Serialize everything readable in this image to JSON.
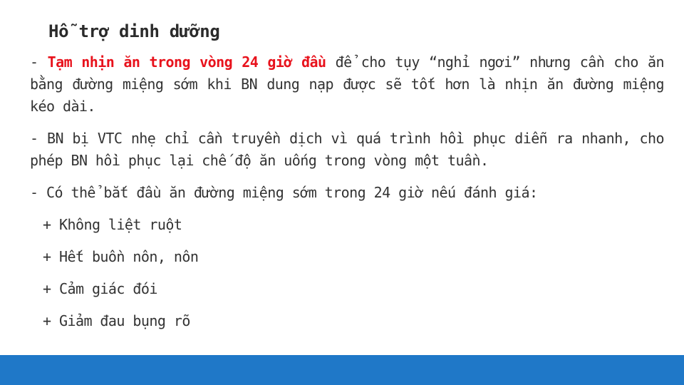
{
  "slide": {
    "title": "Hỗ trợ dinh dưỡng",
    "paragraphs": {
      "p1": {
        "prefix": " - ",
        "highlight": "Tạm nhịn ăn trong vòng 24 giờ đầu",
        "rest": " để cho tụy “nghỉ ngơi” nhưng cần cho ăn bằng đường miệng sớm khi BN dung nạp được sẽ tốt hơn là nhịn ăn đường miệng kéo dài."
      },
      "p2": " - BN bị VTC nhẹ chỉ cần truyền dịch vì quá trình hồi phục diễn ra nhanh, cho phép BN hồi phục lại chế độ ăn uống trong vòng một tuần.",
      "p3": " - Có thể bắt đầu ăn đường miệng sớm trong 24 giờ nếu đánh giá:"
    },
    "criteria": [
      "+ Không liệt ruột",
      "+ Hết buồn nôn, nôn",
      "+ Cảm giác đói",
      "+ Giảm đau bụng rõ"
    ]
  },
  "colors": {
    "highlight": "#e8121c",
    "footer_bar": "#1f78c8",
    "footer_line": "#2fa4dc"
  }
}
